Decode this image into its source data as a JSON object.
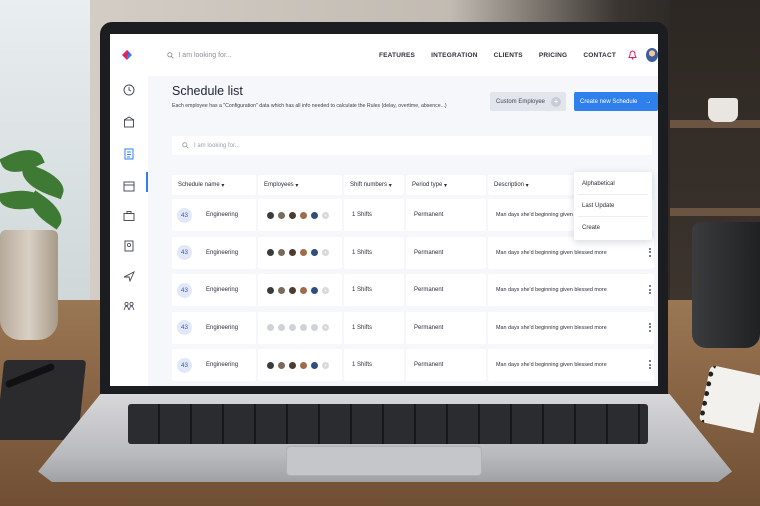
{
  "topbar": {
    "search_placeholder": "I am looking for...",
    "nav": [
      "FEATURES",
      "INTEGRATION",
      "CLIENTS",
      "PRICING",
      "CONTACT"
    ]
  },
  "page": {
    "title": "Schedule list",
    "description": "Each employee has a \"Configuration\" data which has all info needed to calculate the Rules  (delay, overtime, absence...)",
    "custom_button": "Custom Employee",
    "create_button": "Create new Schedule",
    "search_placeholder": "I am looking for..."
  },
  "table": {
    "headers": [
      "Schedule name",
      "Employees",
      "Shift numbers",
      "Period type",
      "Description"
    ],
    "rows": [
      {
        "id": "43",
        "name": "Engineering",
        "shifts": "1 Shifts",
        "period": "Permanent",
        "description": "Man days she'd beginning given blessed more"
      },
      {
        "id": "43",
        "name": "Engineering",
        "shifts": "1 Shifts",
        "period": "Permanent",
        "description": "Man days she'd beginning given blessed more"
      },
      {
        "id": "43",
        "name": "Engineering",
        "shifts": "1 Shifts",
        "period": "Permanent",
        "description": "Man days she'd beginning given blessed more"
      },
      {
        "id": "43",
        "name": "Engineering",
        "shifts": "1 Shifts",
        "period": "Permanent",
        "description": "Man days she'd beginning given blessed more"
      },
      {
        "id": "43",
        "name": "Engineering",
        "shifts": "1 Shifts",
        "period": "Permanent",
        "description": "Man days she'd beginning given blessed more"
      }
    ]
  },
  "sort_menu": [
    "Alphabetical",
    "Last Update",
    "Create"
  ],
  "colors": {
    "accent": "#2f80ed",
    "badge_bg": "#e2e8f7",
    "page_bg": "#f6f7fb"
  }
}
